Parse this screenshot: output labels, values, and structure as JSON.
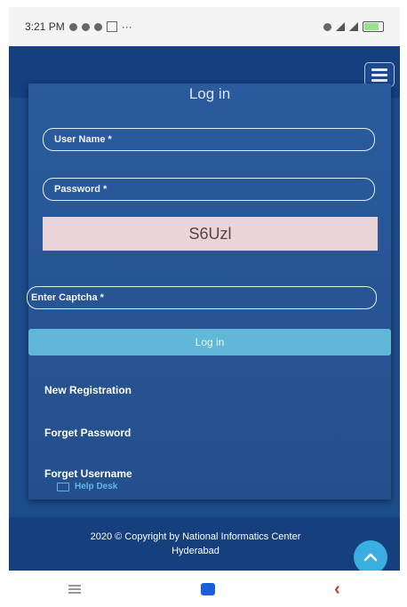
{
  "status_bar": {
    "time": "3:21 PM",
    "dots": "···"
  },
  "header": {
    "menu_icon": "hamburger-menu-icon"
  },
  "login_card": {
    "title": "Log in",
    "username_label": "User Name *",
    "password_label": "Password *",
    "captcha_text": "S6Uzl",
    "captcha_input_label": "Enter Captcha *",
    "login_button": "Log in",
    "links": [
      "New Registration",
      "Forget Password",
      "Forget Username"
    ],
    "help_desk": "Help Desk"
  },
  "footer": {
    "line1": "2020 © Copyright by National Informatics Center",
    "line2": "Hyderabad"
  },
  "icons": {
    "scroll_top": "chevron-up-icon",
    "help_desk": "monitor-icon"
  },
  "colors": {
    "background": "#1c4c8a",
    "card": "#2a5b9c",
    "captcha": "#e9d4d8",
    "login_button": "#61b7d8",
    "scroll_top": "#3aaee0"
  }
}
